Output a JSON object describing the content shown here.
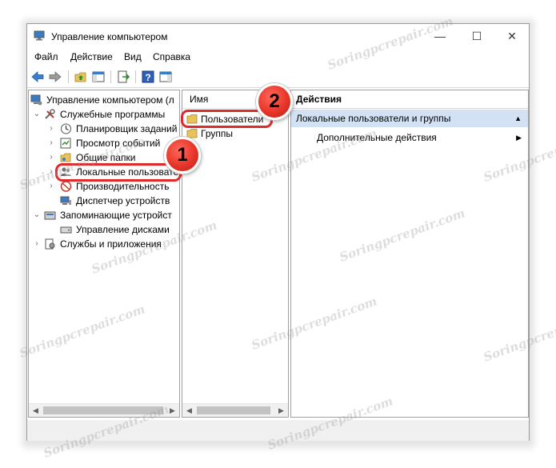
{
  "window": {
    "title": "Управление компьютером",
    "controls": {
      "minimize": "—",
      "maximize": "☐",
      "close": "✕"
    }
  },
  "menu": [
    "Файл",
    "Действие",
    "Вид",
    "Справка"
  ],
  "tree": {
    "root": "Управление компьютером (л",
    "service_programs": "Служебные программы",
    "scheduler": "Планировщик заданий",
    "event_viewer": "Просмотр событий",
    "shared_folders": "Общие папки",
    "local_users": "Локальные пользовате",
    "performance": "Производительность",
    "device_manager": "Диспетчер устройств",
    "storage": "Запоминающие устройст",
    "disk_management": "Управление дисками",
    "services_apps": "Службы и приложения"
  },
  "list": {
    "column_name": "Имя",
    "items": [
      "Пользователи",
      "Группы"
    ]
  },
  "actions": {
    "header": "Действия",
    "section": "Локальные пользователи и группы",
    "more_actions": "Дополнительные действия"
  },
  "callouts": {
    "one": "1",
    "two": "2"
  },
  "watermark": "Soringpcrepair.com",
  "colors": {
    "callout_red": "#e0292b",
    "action_section_bg": "#d2e2f4",
    "folder_yellow": "#e8c25a"
  }
}
